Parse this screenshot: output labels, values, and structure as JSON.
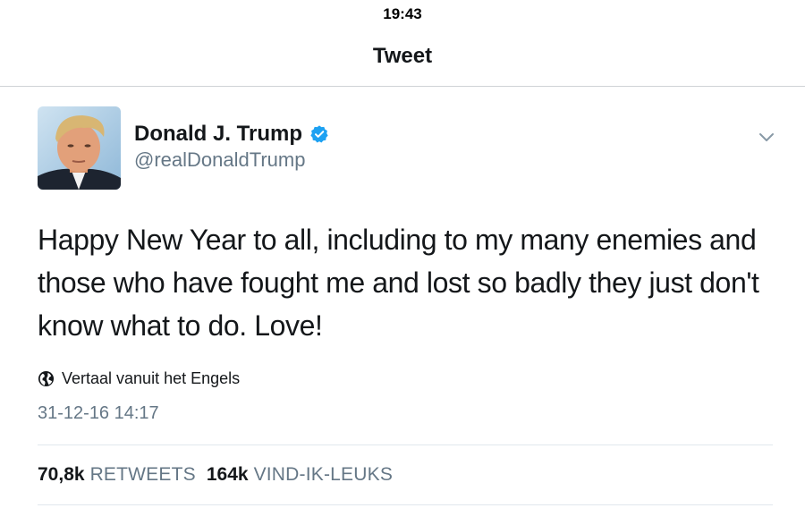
{
  "status_bar": {
    "time": "19:43"
  },
  "nav": {
    "title": "Tweet"
  },
  "tweet": {
    "author": {
      "display_name": "Donald J. Trump",
      "handle": "@realDonaldTrump",
      "verified": true,
      "avatar_icon": "profile-photo"
    },
    "text": "Happy New Year to all, including to my many enemies and those who have fought me and lost so badly they just don't know what to do. Love!",
    "translate_label": "Vertaal vanuit het Engels",
    "timestamp": "31-12-16 14:17",
    "stats": {
      "retweets_count": "70,8k",
      "retweets_label": "RETWEETS",
      "likes_count": "164k",
      "likes_label": "VIND-IK-LEUKS"
    }
  },
  "colors": {
    "verified_blue": "#1da1f2",
    "secondary_text": "#657786",
    "primary_text": "#14171a"
  }
}
